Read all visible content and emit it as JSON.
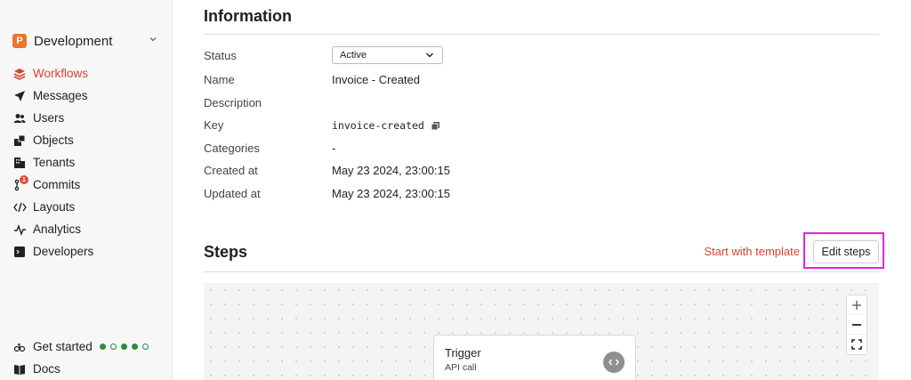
{
  "sidebar": {
    "environment": {
      "badge": "P",
      "label": "Development"
    },
    "nav": [
      {
        "label": "Workflows",
        "icon": "layers-icon",
        "active": true
      },
      {
        "label": "Messages",
        "icon": "paper-plane-icon"
      },
      {
        "label": "Users",
        "icon": "users-icon"
      },
      {
        "label": "Objects",
        "icon": "objects-icon"
      },
      {
        "label": "Tenants",
        "icon": "building-icon"
      },
      {
        "label": "Commits",
        "icon": "git-commit-icon",
        "badge": "1"
      },
      {
        "label": "Layouts",
        "icon": "code-icon"
      },
      {
        "label": "Analytics",
        "icon": "pulse-icon"
      },
      {
        "label": "Developers",
        "icon": "terminal-icon"
      }
    ],
    "bottom": [
      {
        "label": "Get started",
        "icon": "people-icon"
      },
      {
        "label": "Docs",
        "icon": "book-icon"
      }
    ],
    "progress": {
      "filled": 3,
      "total": 5
    }
  },
  "information": {
    "title": "Information",
    "status_label": "Status",
    "status_value": "Active",
    "name_label": "Name",
    "name_value": "Invoice - Created",
    "description_label": "Description",
    "key_label": "Key",
    "key_value": "invoice-created",
    "categories_label": "Categories",
    "categories_value": "-",
    "created_label": "Created at",
    "created_value": "May 23 2024, 23:00:15",
    "updated_label": "Updated at",
    "updated_value": "May 23 2024, 23:00:15"
  },
  "steps": {
    "title": "Steps",
    "template_link": "Start with template",
    "edit_button": "Edit steps",
    "trigger": {
      "title": "Trigger",
      "subtitle": "API call"
    }
  },
  "colors": {
    "accent": "#d9442f",
    "highlight": "#e024e0",
    "progress": "#2e8b3e",
    "badge": "#e8782b"
  }
}
